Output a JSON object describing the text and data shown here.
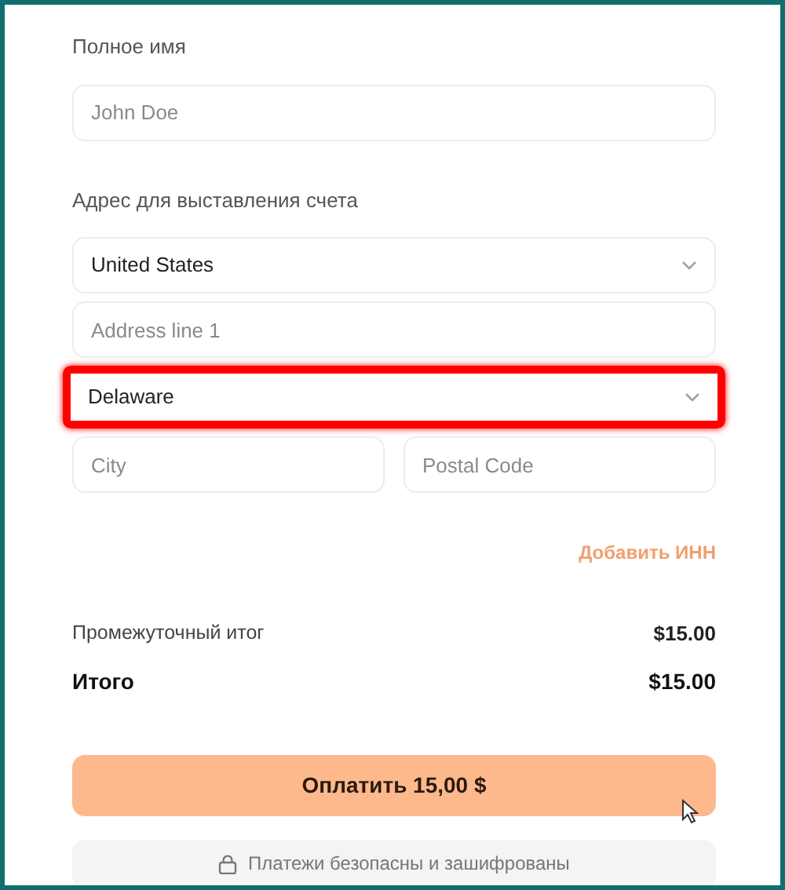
{
  "full_name": {
    "label": "Полное имя",
    "placeholder": "John Doe"
  },
  "billing_address": {
    "label": "Адрес для выставления счета",
    "fields": [
      {
        "kind": "select",
        "value": "United States",
        "highlighted": false
      },
      {
        "kind": "input",
        "placeholder": "Address line 1",
        "highlighted": false
      },
      {
        "kind": "select",
        "value": "Delaware",
        "highlighted": true
      }
    ],
    "row": [
      {
        "kind": "input",
        "placeholder": "City"
      },
      {
        "kind": "input",
        "placeholder": "Postal Code"
      }
    ]
  },
  "add_tax_id_link": "Добавить ИНН",
  "summary": [
    {
      "label": "Промежуточный итог",
      "amount": "$15.00",
      "kind": "subtotal"
    },
    {
      "label": "Итого",
      "amount": "$15.00",
      "kind": "total"
    }
  ],
  "pay_button": "Оплатить 15,00 $",
  "secure_note": "Платежи безопасны и зашифрованы"
}
